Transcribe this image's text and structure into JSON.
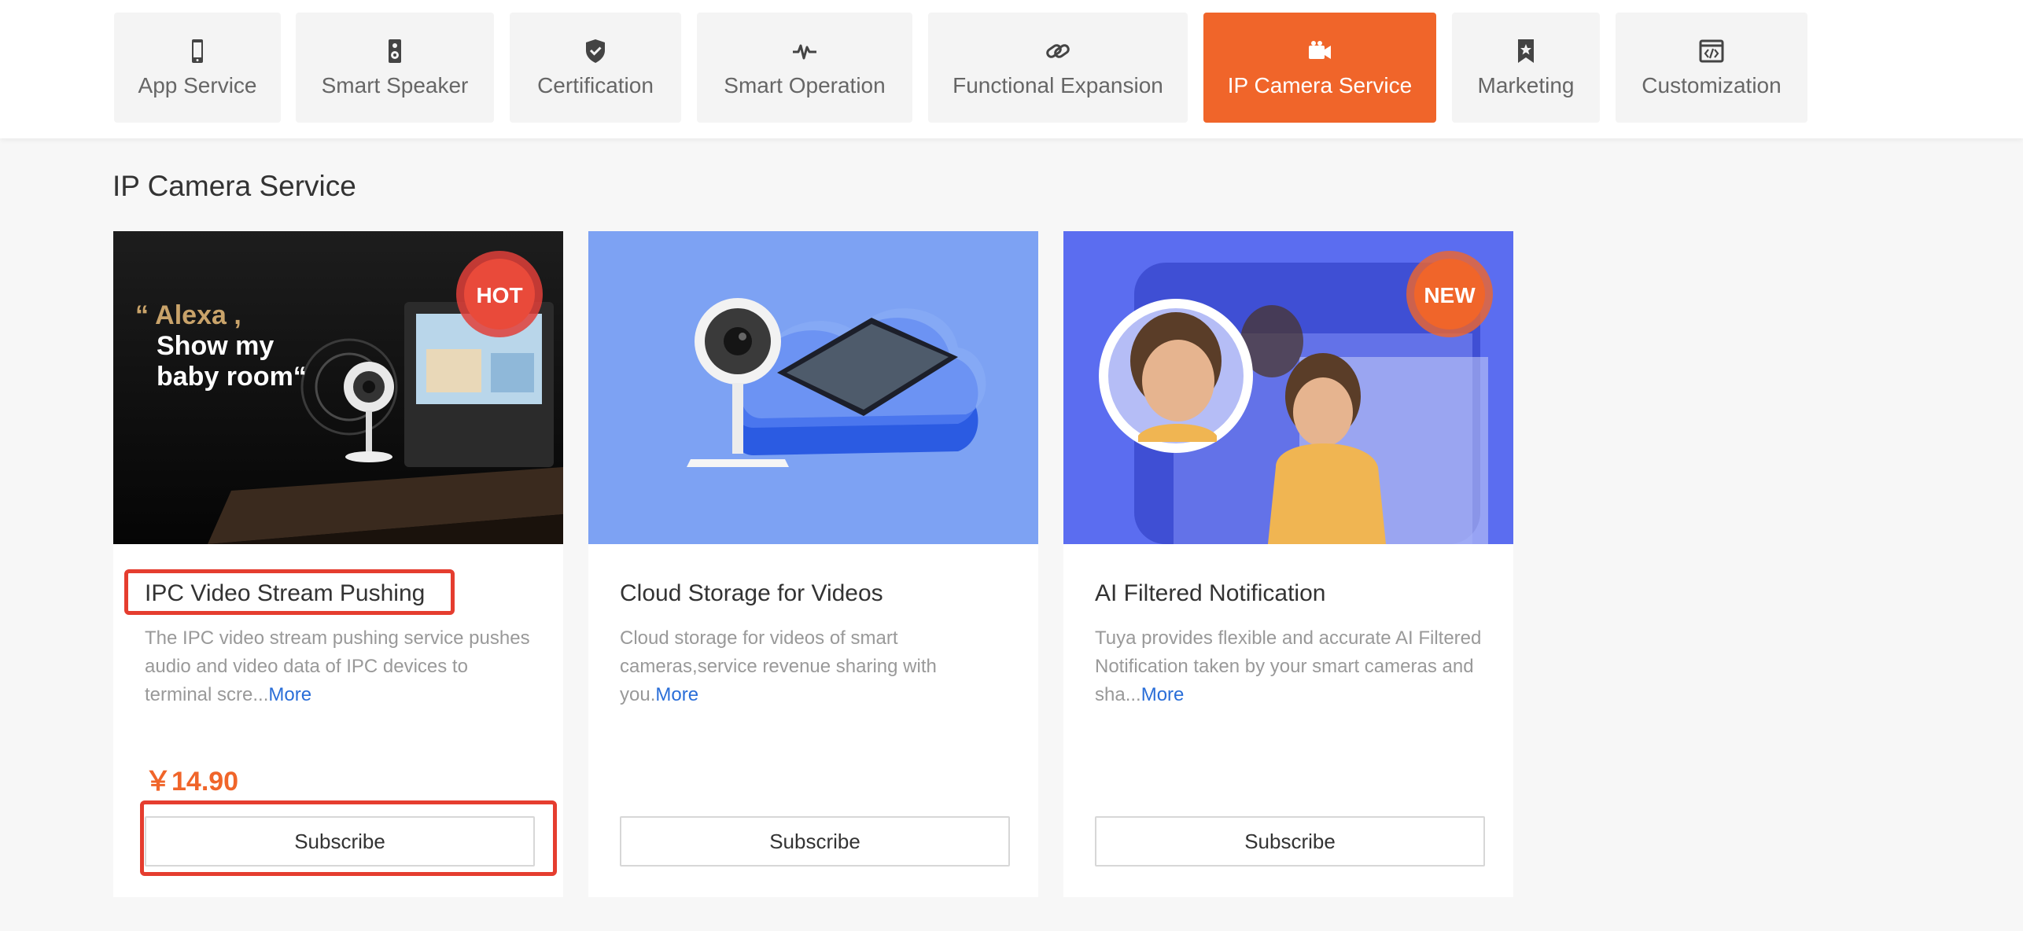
{
  "tabs": [
    {
      "label": "App Service",
      "icon": "phone-icon"
    },
    {
      "label": "Smart Speaker",
      "icon": "speaker-icon"
    },
    {
      "label": "Certification",
      "icon": "shield-check-icon"
    },
    {
      "label": "Smart Operation",
      "icon": "pulse-icon"
    },
    {
      "label": "Functional Expansion",
      "icon": "link-icon"
    },
    {
      "label": "IP Camera Service",
      "icon": "video-camera-icon",
      "active": true
    },
    {
      "label": "Marketing",
      "icon": "bookmark-star-icon"
    },
    {
      "label": "Customization",
      "icon": "code-window-icon"
    }
  ],
  "section": {
    "title": "IP Camera Service"
  },
  "cards": [
    {
      "title": "IPC Video Stream Pushing",
      "desc": "The IPC video stream pushing service pushes audio and video data of IPC devices to terminal scre...",
      "more": "More",
      "price": "￥14.90",
      "subscribe": "Subscribe",
      "badge": "HOT",
      "image_text": {
        "line1": "“ Alexa ,",
        "line2": "Show my",
        "line3": "baby room“"
      }
    },
    {
      "title": "Cloud Storage for Videos",
      "desc": "Cloud storage for videos of smart cameras,service revenue sharing with you.",
      "more": "More",
      "subscribe": "Subscribe"
    },
    {
      "title": "AI Filtered Notification",
      "desc": "Tuya provides flexible and accurate AI Filtered Notification taken by your smart cameras and sha...",
      "more": "More",
      "subscribe": "Subscribe",
      "badge": "NEW"
    }
  ],
  "colors": {
    "accent": "#f0652a",
    "highlight": "#e53d2f",
    "link": "#2a6ed8"
  }
}
